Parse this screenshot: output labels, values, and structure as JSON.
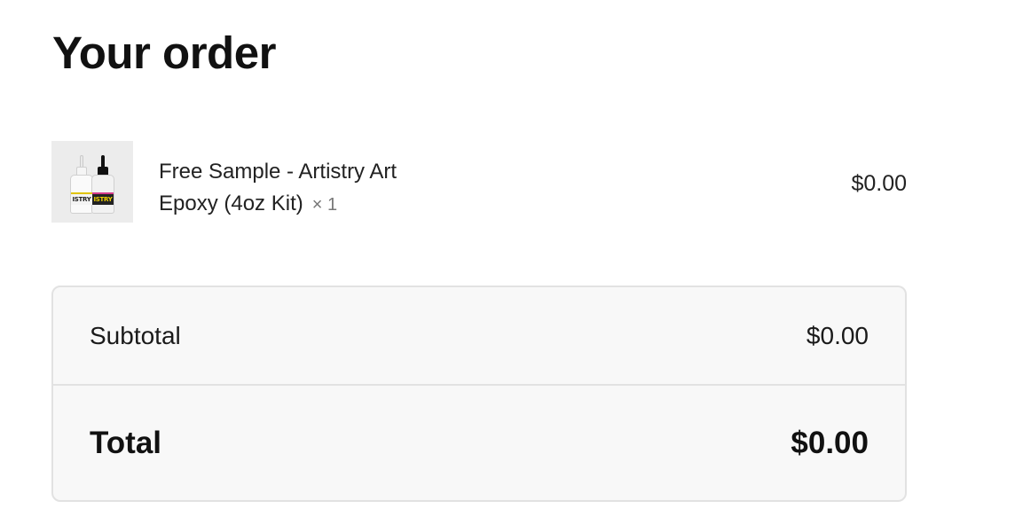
{
  "page": {
    "title": "Your order"
  },
  "order_items": [
    {
      "name": "Free Sample - Artistry Art Epoxy (4oz Kit)",
      "quantity": "× 1",
      "price": "$0.00",
      "image": "product-bottles-image",
      "bottle_labels": [
        "ISTRY",
        "ISTRY"
      ]
    }
  ],
  "summary": {
    "subtotal_label": "Subtotal",
    "subtotal_value": "$0.00",
    "total_label": "Total",
    "total_value": "$0.00"
  },
  "colors": {
    "summary_background": "#f8f8f8",
    "summary_border": "#e2e2e2",
    "text": "#1a1a1a",
    "muted_text": "#777777"
  }
}
